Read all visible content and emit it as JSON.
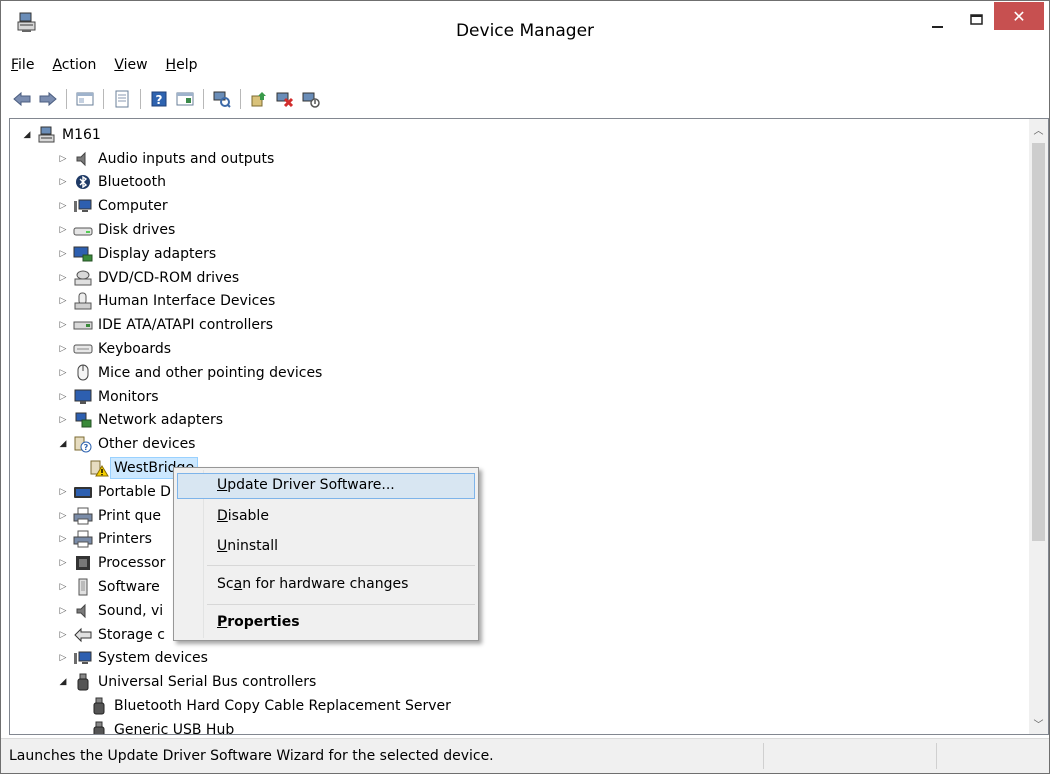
{
  "window": {
    "title": "Device Manager"
  },
  "menubar": [
    {
      "label": "File",
      "accel": "F",
      "rest": "ile"
    },
    {
      "label": "Action",
      "accel": "A",
      "rest": "ction"
    },
    {
      "label": "View",
      "accel": "V",
      "rest": "iew"
    },
    {
      "label": "Help",
      "accel": "H",
      "rest": "elp"
    }
  ],
  "toolbar": {
    "buttons": [
      "back",
      "forward",
      "show-hide-console-tree",
      "properties",
      "help",
      "show-action-pane",
      "scan-hardware-changes",
      "update-driver",
      "uninstall-device",
      "disable-device"
    ]
  },
  "tree": {
    "root": "M161",
    "categories": [
      {
        "label": "Audio inputs and outputs",
        "icon": "speaker-icon"
      },
      {
        "label": "Bluetooth",
        "icon": "bluetooth-icon"
      },
      {
        "label": "Computer",
        "icon": "computer-icon"
      },
      {
        "label": "Disk drives",
        "icon": "disk-drive-icon"
      },
      {
        "label": "Display adapters",
        "icon": "display-adapter-icon"
      },
      {
        "label": "DVD/CD-ROM drives",
        "icon": "dvd-drive-icon"
      },
      {
        "label": "Human Interface Devices",
        "icon": "hid-icon"
      },
      {
        "label": "IDE ATA/ATAPI controllers",
        "icon": "ide-controller-icon"
      },
      {
        "label": "Keyboards",
        "icon": "keyboard-icon"
      },
      {
        "label": "Mice and other pointing devices",
        "icon": "mouse-icon"
      },
      {
        "label": "Monitors",
        "icon": "monitor-icon"
      },
      {
        "label": "Network adapters",
        "icon": "network-adapter-icon"
      },
      {
        "label": "Other devices",
        "icon": "unknown-device-icon",
        "expanded": true
      },
      {
        "label": "WestBridge",
        "icon": "warning-device-icon",
        "child": true,
        "selected": true
      },
      {
        "label": "Portable Devices",
        "icon": "portable-device-icon",
        "visible_text": "Portable D"
      },
      {
        "label": "Print queues",
        "icon": "printer-icon",
        "visible_text": "Print que"
      },
      {
        "label": "Printers",
        "icon": "printer-icon"
      },
      {
        "label": "Processors",
        "icon": "processor-icon",
        "visible_text": "Processor"
      },
      {
        "label": "Software devices",
        "icon": "software-device-icon",
        "visible_text": "Software"
      },
      {
        "label": "Sound, video and game controllers",
        "icon": "speaker-icon",
        "visible_text": "Sound, vi"
      },
      {
        "label": "Storage controllers",
        "icon": "storage-controller-icon",
        "visible_text": "Storage c"
      },
      {
        "label": "System devices",
        "icon": "computer-icon"
      },
      {
        "label": "Universal Serial Bus controllers",
        "icon": "usb-icon",
        "expanded": true
      },
      {
        "label": "Bluetooth Hard Copy Cable Replacement Server",
        "icon": "usb-icon",
        "child": true
      },
      {
        "label": "Generic USB Hub",
        "icon": "usb-icon",
        "child": true
      }
    ]
  },
  "context_menu": {
    "items": [
      {
        "label": "Update Driver Software...",
        "accel": "U",
        "rest": "pdate Driver Software...",
        "hover": true
      },
      {
        "label": "Disable",
        "accel": "D",
        "rest": "isable"
      },
      {
        "label": "Uninstall",
        "accel": "U",
        "rest": "ninstall"
      },
      {
        "label": "Scan for hardware changes",
        "pre": "Sc",
        "accel": "a",
        "rest": "n for hardware changes"
      },
      {
        "label": "Properties",
        "accel": "P",
        "rest": "roperties",
        "bold": true
      }
    ]
  },
  "status": {
    "text": "Launches the Update Driver Software Wizard for the selected device."
  },
  "colors": {
    "close_button": "#c75050",
    "selection": "#cce8ff",
    "menu_hover": "#d8e6f2"
  }
}
